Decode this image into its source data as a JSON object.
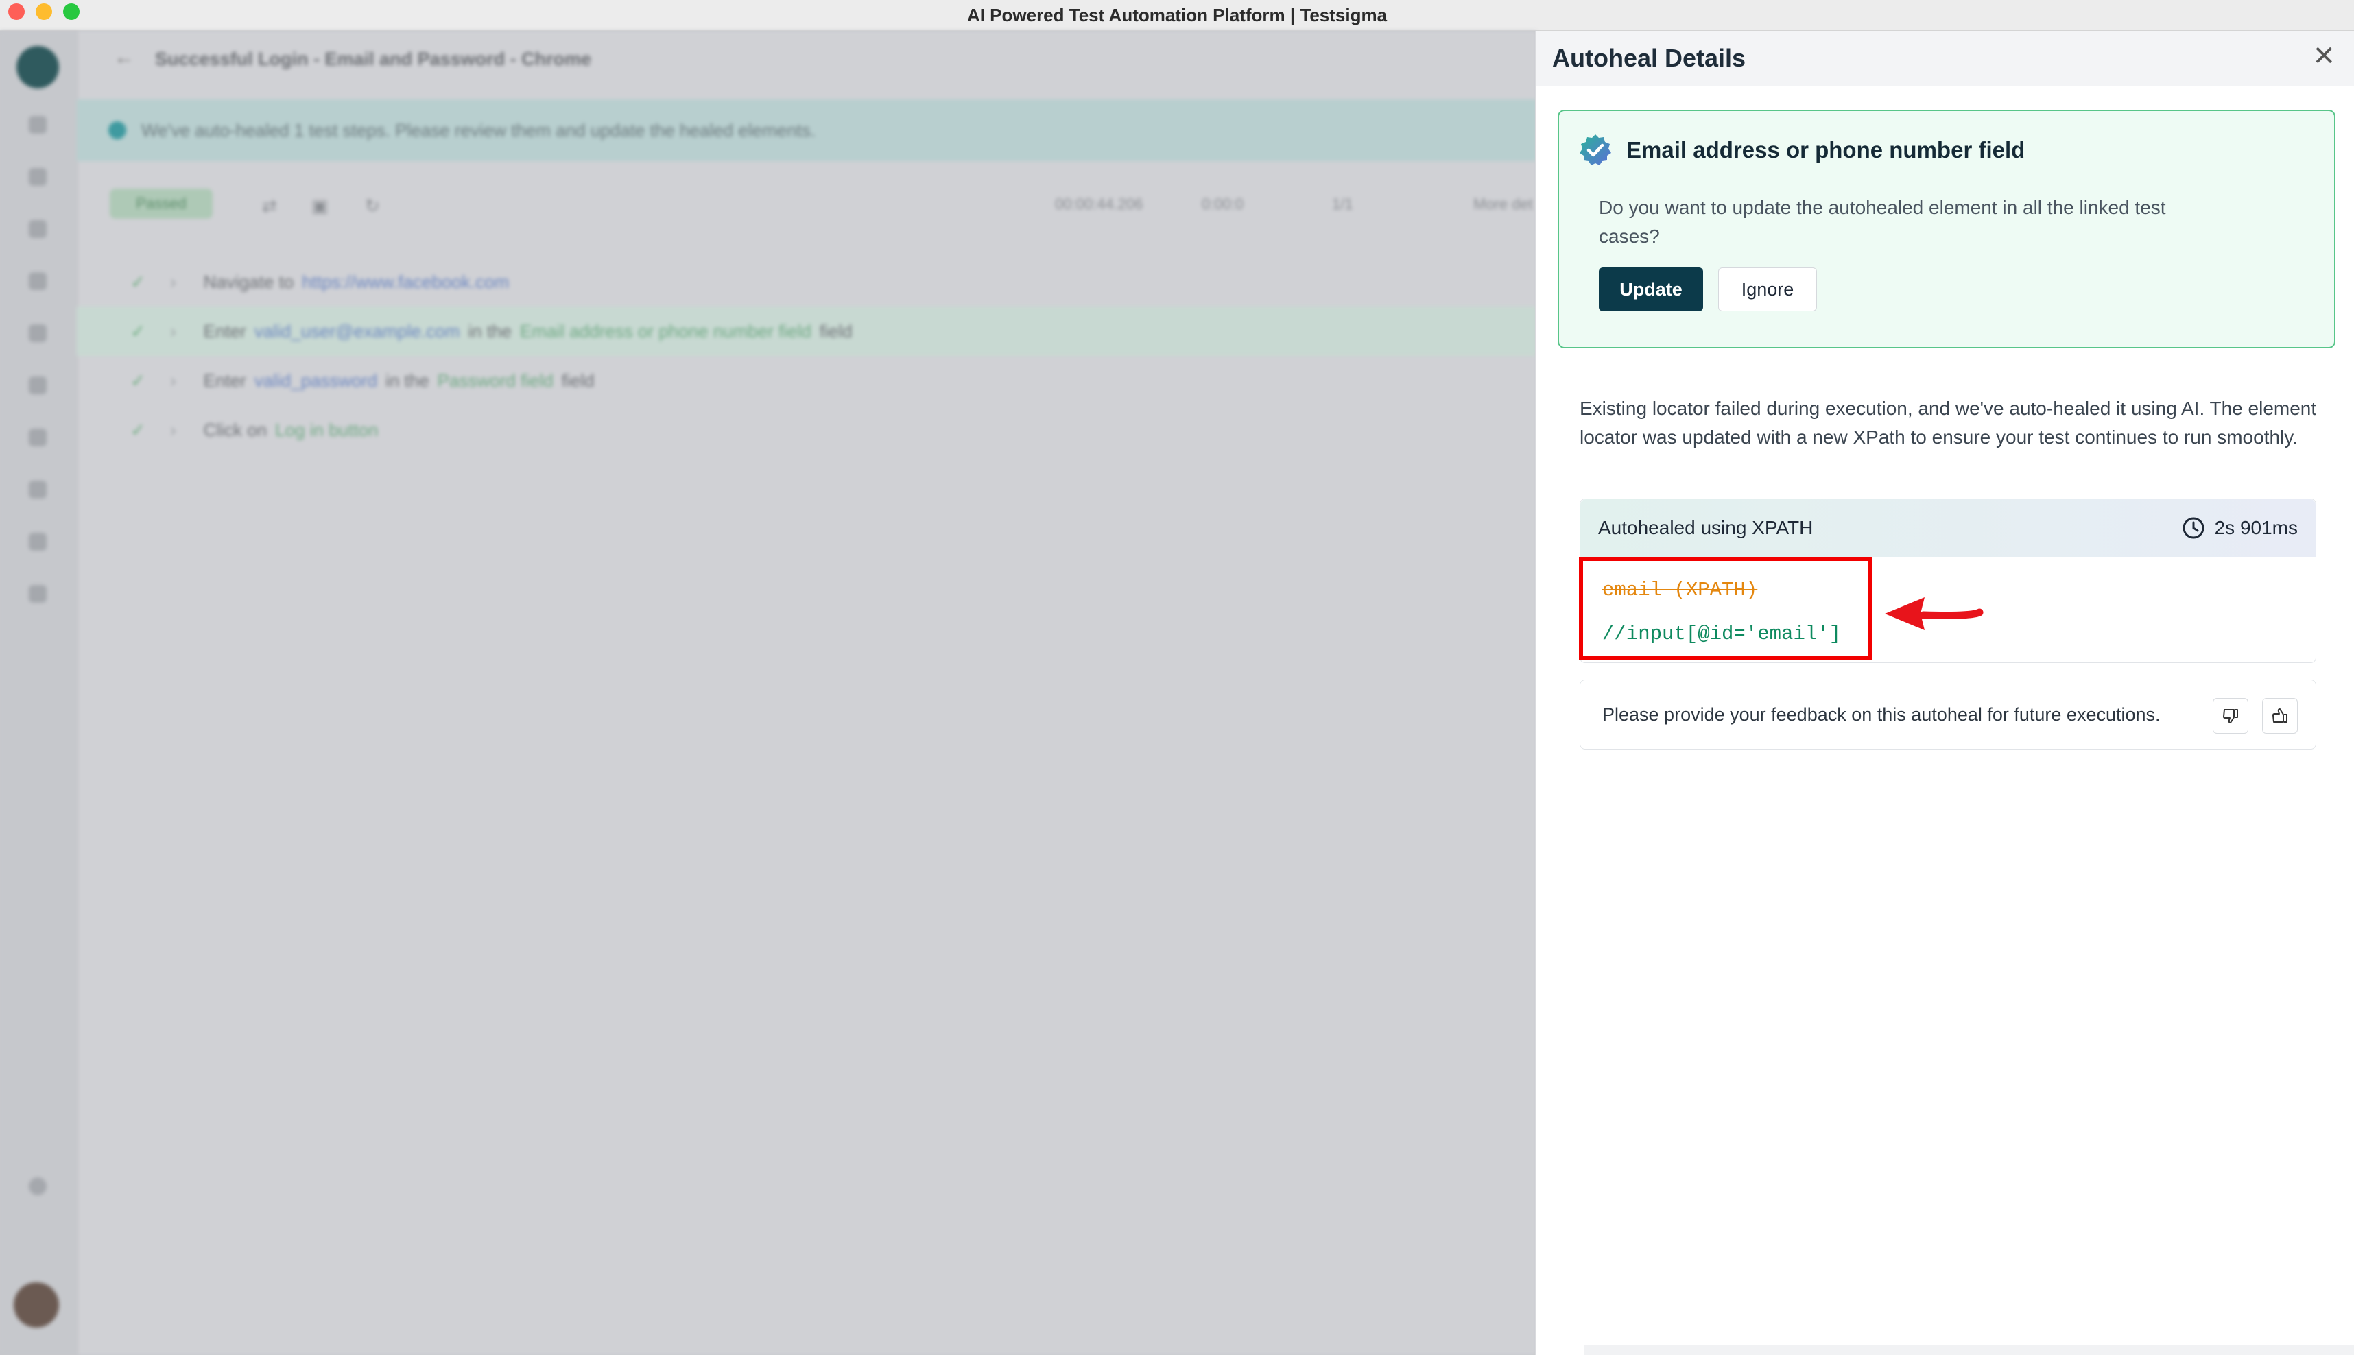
{
  "window": {
    "title": "AI Powered Test Automation Platform | Testsigma"
  },
  "background": {
    "breadcrumb": "Successful Login - Email and Password - Chrome",
    "banner_text": "We've auto-healed 1 test steps. Please review them and update the healed elements.",
    "status_pill": "Passed",
    "meta": [
      "00:00:44.206",
      "0:00:0",
      "1/1",
      "More det"
    ],
    "steps": [
      {
        "verb": "Navigate to",
        "link": "https://www.facebook.com",
        "after": "",
        "target": "",
        "suffix": ""
      },
      {
        "verb": "Enter",
        "link": "valid_user@example.com",
        "after": "in the",
        "target": "Email address or phone number field",
        "suffix": "field"
      },
      {
        "verb": "Enter",
        "link": "valid_password",
        "after": "in the",
        "target": "Password field",
        "suffix": "field"
      },
      {
        "verb": "Click on",
        "link": "",
        "after": "",
        "target": "Log in button",
        "suffix": ""
      }
    ]
  },
  "panel": {
    "title": "Autoheal Details",
    "notice": {
      "title": "Email address or phone number field",
      "question": "Do you want to update the autohealed element in all the linked test cases?",
      "update_label": "Update",
      "ignore_label": "Ignore"
    },
    "description": "Existing locator failed during execution, and we've auto-healed it using AI. The element locator was updated with a new XPath to ensure your test continues to run smoothly.",
    "heal": {
      "label": "Autohealed using XPATH",
      "duration": "2s 901ms",
      "old_locator": "email (XPATH)",
      "new_locator": "//input[@id='email']"
    },
    "feedback": {
      "text": "Please provide your feedback on this autoheal for future executions."
    }
  },
  "colors": {
    "accent": "#0c3a4a",
    "success": "#58c589",
    "highlight": "#f20000"
  }
}
